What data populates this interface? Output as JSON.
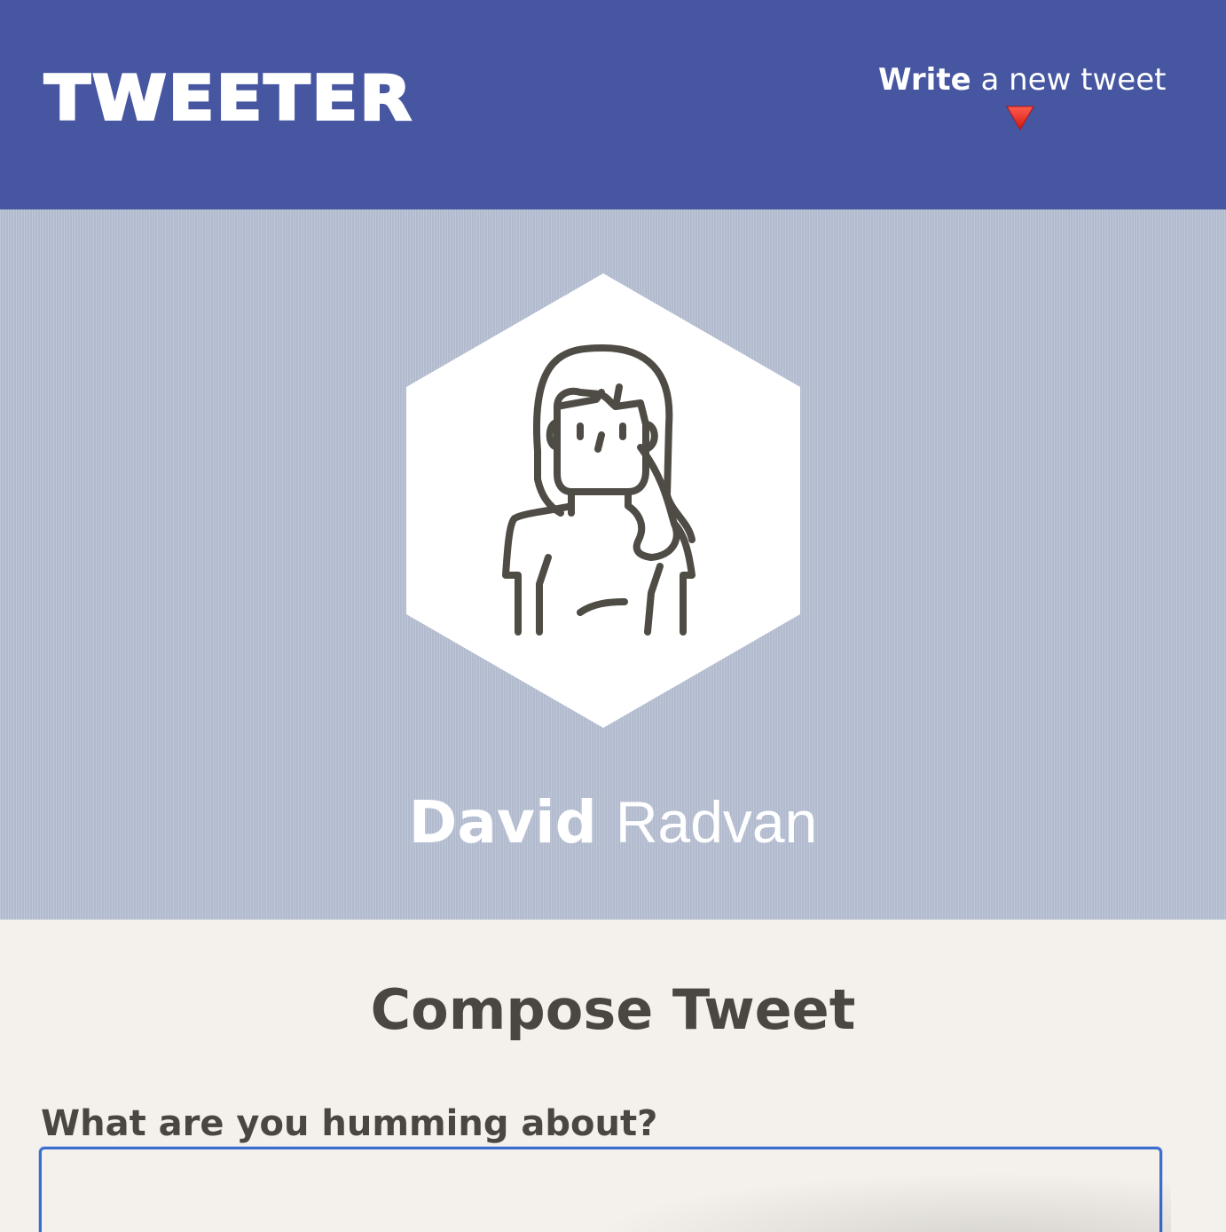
{
  "app": {
    "logo_text": "TWEETER"
  },
  "nav": {
    "compose_bold": "Write",
    "compose_rest": " a new tweet",
    "compose_icon": "red-down-triangle-icon"
  },
  "profile": {
    "first_name": "David",
    "last_name": "Radvan",
    "avatar_icon": "user-avatar-icon"
  },
  "compose": {
    "title": "Compose Tweet",
    "prompt": "What are you humming about?",
    "value": "",
    "placeholder": ""
  },
  "colors": {
    "header": "#4656a0",
    "banner": "#b8c1d5",
    "page": "#f4f1ec",
    "text_dark": "#4a4743",
    "focus": "#3a6fd0",
    "arrow": "#e2231a"
  }
}
